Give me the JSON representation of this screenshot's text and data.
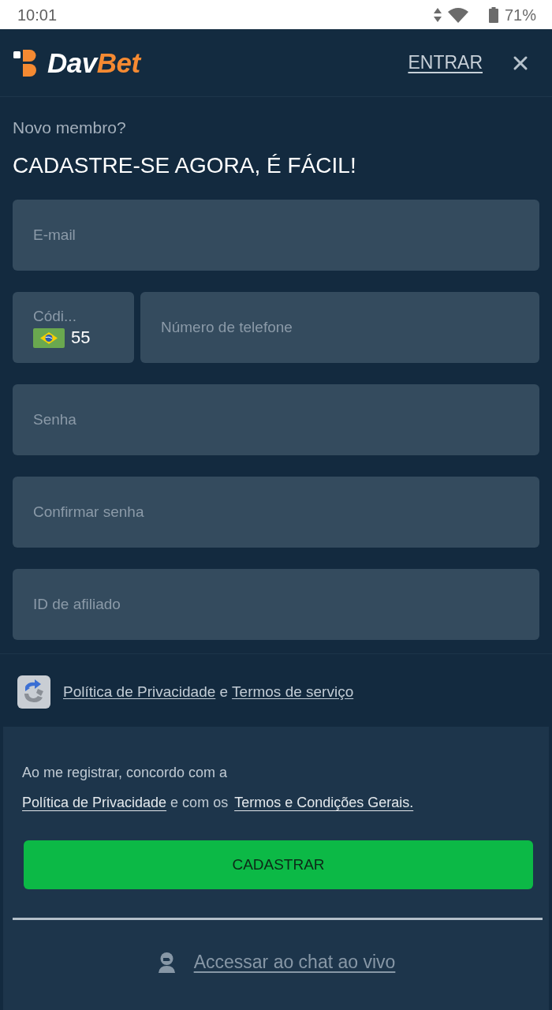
{
  "status_bar": {
    "time": "10:01",
    "battery": "71%"
  },
  "header": {
    "logo": {
      "first": "Dav",
      "second": "Bet"
    },
    "login_link": "ENTRAR"
  },
  "intro": {
    "subtitle": "Novo membro?",
    "title": "CADASTRE-SE AGORA, É FÁCIL!"
  },
  "fields": [
    {
      "kind": "text",
      "placeholder": "E-mail"
    },
    {
      "kind": "phone",
      "code_label": "Códi...",
      "code_value": "55",
      "placeholder": "Número de telefone"
    },
    {
      "kind": "password",
      "placeholder": "Senha"
    },
    {
      "kind": "password",
      "placeholder": "Confirmar senha"
    },
    {
      "kind": "text",
      "placeholder": "ID de afiliado"
    }
  ],
  "recaptcha": {
    "privacy_link": "Política de Privacidade",
    "connector": "e",
    "terms_link": "Termos de serviço"
  },
  "agreement": {
    "text": "Ao me registrar, concordo com a",
    "privacy_link": "Política de Privacidade",
    "connector": "e com os",
    "terms_link": "Termos e Condições Gerais."
  },
  "submit_button": "CADASTRAR",
  "live_chat_link": "Accessar ao chat ao vivo"
}
